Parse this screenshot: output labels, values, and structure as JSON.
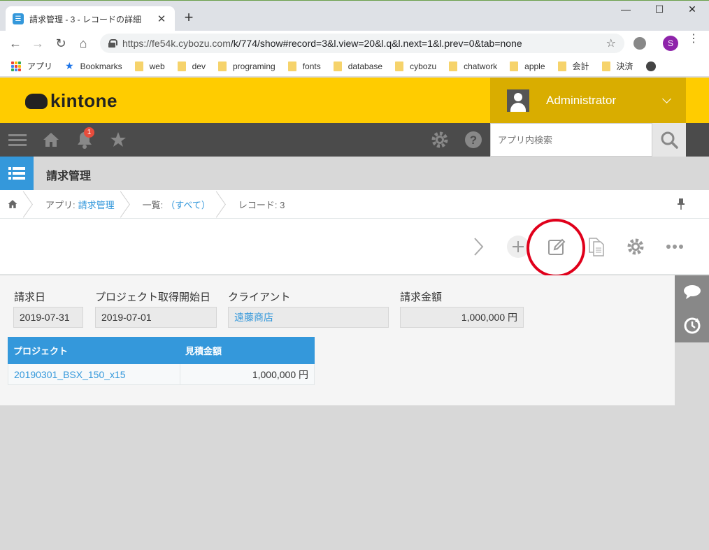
{
  "browser": {
    "tab_title": "請求管理 - 3 - レコードの詳細",
    "url_domain": "https://fe54k.cybozu.com",
    "url_path": "/k/774/show#record=3&l.view=20&l.q&l.next=1&l.prev=0&tab=none",
    "profile_initial": "S",
    "bookmarks": [
      {
        "label": "アプリ",
        "icon": "apps-icon"
      },
      {
        "label": "Bookmarks",
        "icon": "star-icon"
      },
      {
        "label": "web",
        "icon": "folder-icon"
      },
      {
        "label": "dev",
        "icon": "folder-icon"
      },
      {
        "label": "programing",
        "icon": "folder-icon"
      },
      {
        "label": "fonts",
        "icon": "folder-icon"
      },
      {
        "label": "database",
        "icon": "folder-icon"
      },
      {
        "label": "cybozu",
        "icon": "folder-icon"
      },
      {
        "label": "chatwork",
        "icon": "folder-icon"
      },
      {
        "label": "apple",
        "icon": "folder-icon"
      },
      {
        "label": "会計",
        "icon": "folder-icon"
      },
      {
        "label": "決済",
        "icon": "folder-icon"
      }
    ]
  },
  "header": {
    "logo_text": "kintone",
    "user_name": "Administrator",
    "notification_count": "1",
    "search_placeholder": "アプリ内検索"
  },
  "app": {
    "title": "請求管理"
  },
  "breadcrumb": {
    "app_prefix": "アプリ:",
    "app_name": "請求管理",
    "view_prefix": "一覧:",
    "view_name": "（すべて）",
    "record_label": "レコード: 3"
  },
  "record": {
    "fields": [
      {
        "label": "請求日",
        "value": "2019-07-31"
      },
      {
        "label": "プロジェクト取得開始日",
        "value": "2019-07-01"
      },
      {
        "label": "クライアント",
        "value": "遠藤商店"
      },
      {
        "label": "請求金額",
        "value": "1,000,000 円"
      }
    ],
    "subtable": {
      "headers": [
        "プロジェクト",
        "見積金額"
      ],
      "rows": [
        {
          "project": "20190301_BSX_150_x15",
          "amount": "1,000,000 円"
        }
      ]
    }
  },
  "colors": {
    "kintone_yellow": "#ffcc00",
    "nav_dark": "#4b4b4b",
    "accent_blue": "#3498db",
    "highlight_red": "#e0001b"
  }
}
